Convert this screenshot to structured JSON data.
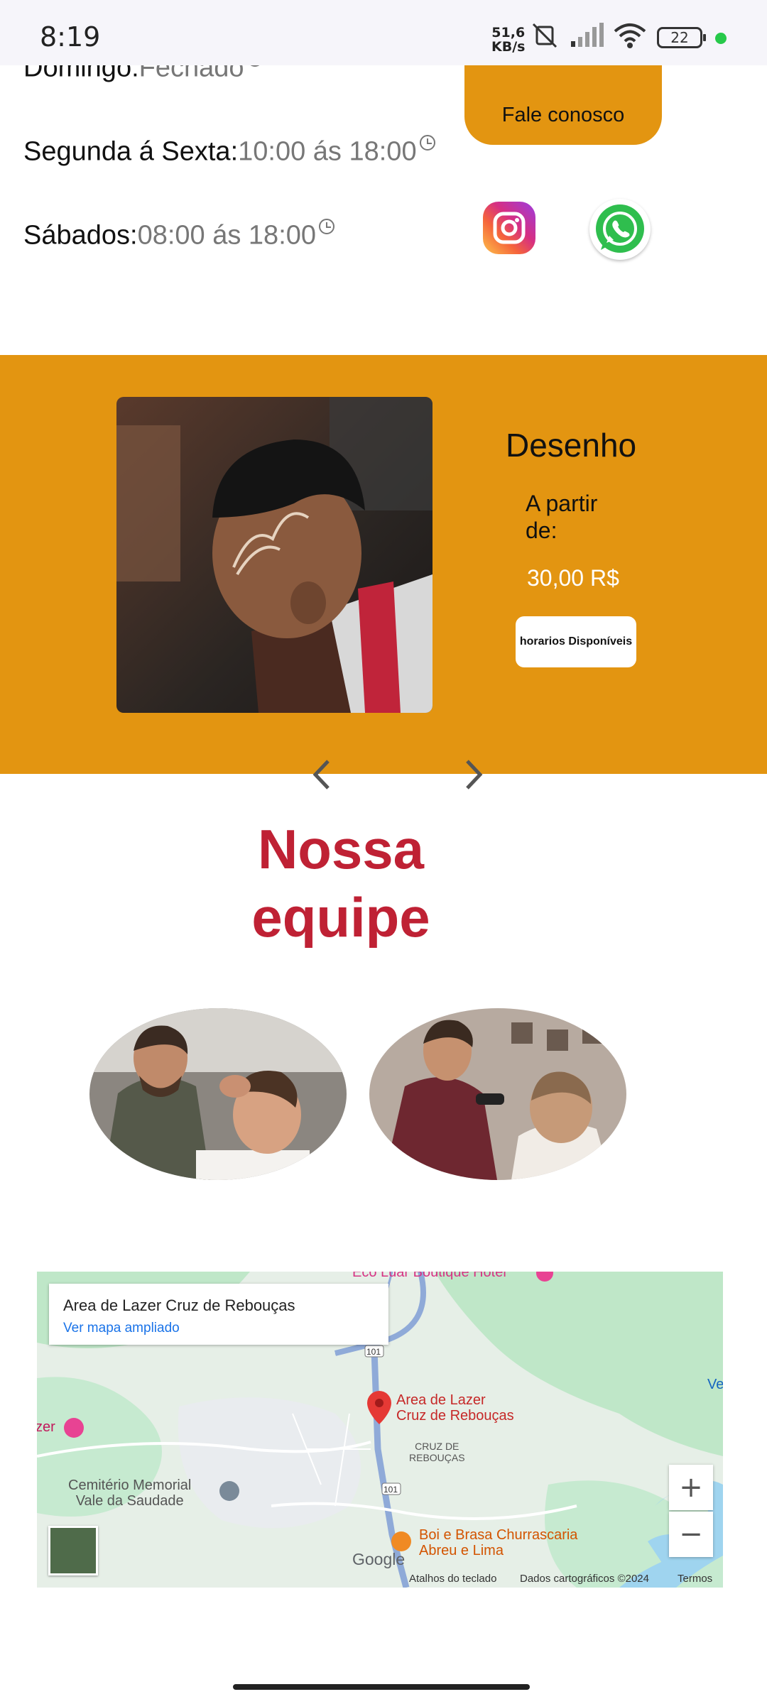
{
  "status_bar": {
    "time": "8:19",
    "speed_value": "51,6",
    "speed_unit": "KB/s",
    "battery": "22"
  },
  "hours": {
    "sunday_label": "Domingo:",
    "sunday_value": "Fechado",
    "weekdays_label": "Segunda á Sexta:",
    "weekdays_value": "10:00 ás 18:00",
    "saturday_label": "Sábados:",
    "saturday_value": "08:00 ás 18:00"
  },
  "contact": {
    "button_label": "Fale conosco",
    "instagram_icon": "instagram-icon",
    "whatsapp_icon": "whatsapp-icon"
  },
  "service": {
    "title": "Desenho",
    "from_label": "A partir de:",
    "price": "30,00 R$",
    "button_label": "horarios Disponíveis"
  },
  "team": {
    "title_line1": "Nossa",
    "title_line2": "equipe"
  },
  "map": {
    "place_name": "Area de Lazer Cruz de Rebouças",
    "link_label": "Ver mapa ampliado",
    "labels": {
      "hotel": "Eco Luar Boutique Hotel",
      "marker_line1": "Area de Lazer",
      "marker_line2": "Cruz de Rebouças",
      "district_line1": "CRUZ DE",
      "district_line2": "REBOUÇAS",
      "cemetery_line1": "Cemitério Memorial",
      "cemetery_line2": "Vale da Saudade",
      "restaurant_line1": "Boi e Brasa Churrascaria",
      "restaurant_line2": "Abreu e Lima",
      "left_edge": "zer",
      "right_edge": "Ve",
      "road1": "101",
      "road2": "101"
    },
    "zoom_in": "+",
    "zoom_out": "−",
    "google": "Google",
    "footer_shortcuts": "Atalhos do teclado",
    "footer_data": "Dados cartográficos ©2024",
    "footer_terms": "Termos"
  },
  "colors": {
    "accent_orange": "#e39511",
    "team_title_red": "#bf2134",
    "link_blue": "#1a73e8"
  }
}
